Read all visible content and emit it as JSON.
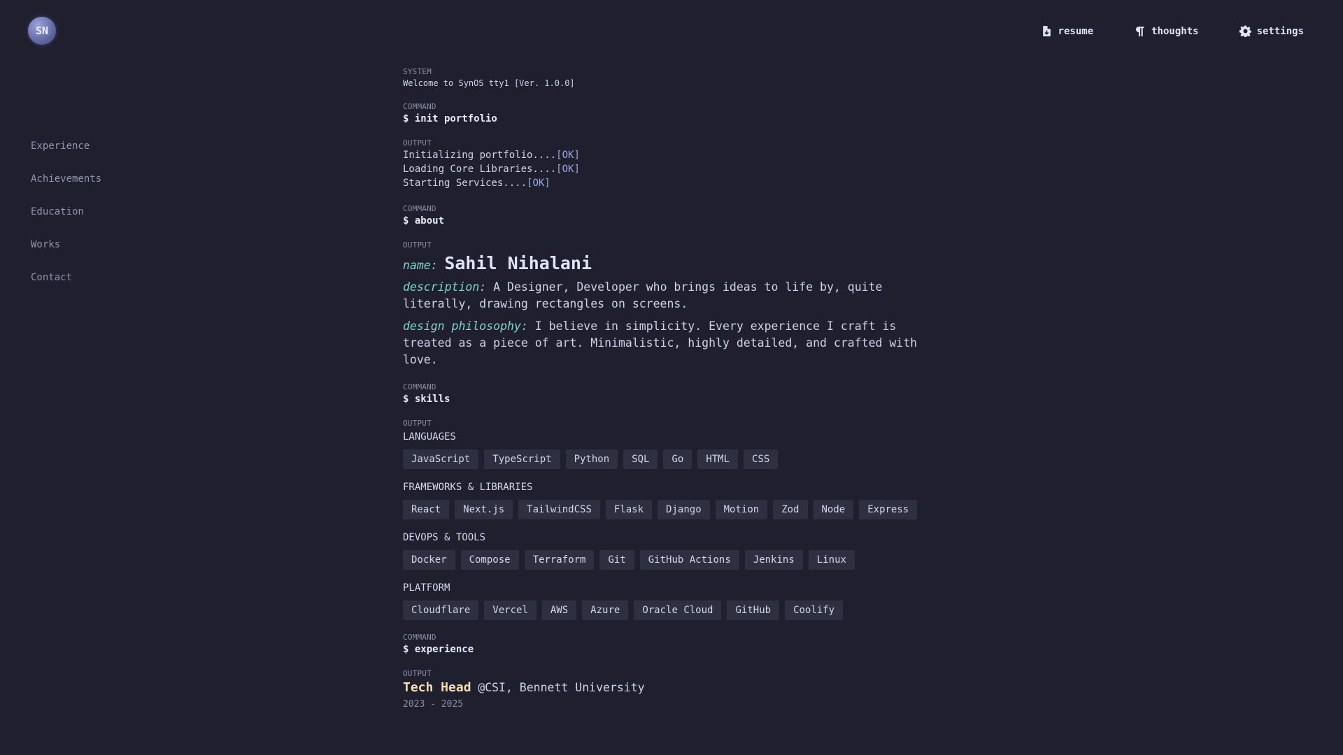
{
  "header": {
    "avatar_initials": "SN",
    "nav": [
      {
        "label": "resume",
        "icon": "document-icon"
      },
      {
        "label": "thoughts",
        "icon": "pilcrow-icon"
      },
      {
        "label": "settings",
        "icon": "gear-icon"
      }
    ]
  },
  "sidebar": {
    "items": [
      "Experience",
      "Achievements",
      "Education",
      "Works",
      "Contact"
    ]
  },
  "terminal": {
    "system": {
      "tag": "SYSTEM",
      "text": "Welcome to SynOS tty1 [Ver. 1.0.0]"
    },
    "cmd_init": {
      "tag": "COMMAND",
      "text": "$ init portfolio"
    },
    "out_init": {
      "tag": "OUTPUT",
      "lines": [
        {
          "text": "Initializing portfolio....",
          "status": "[OK]"
        },
        {
          "text": "Loading Core Libraries....",
          "status": "[OK]"
        },
        {
          "text": "Starting Services....",
          "status": "[OK]"
        }
      ]
    },
    "cmd_about": {
      "tag": "COMMAND",
      "text": "$ about"
    },
    "out_about": {
      "tag": "OUTPUT",
      "name_key": "name:",
      "name": "Sahil Nihalani",
      "desc_key": "description:",
      "desc": "A Designer, Developer who brings ideas to life by, quite literally, drawing rectangles on screens.",
      "philo_key": "design philosophy:",
      "philo": "I believe in simplicity. Every experience I craft is treated as a piece of art. Minimalistic, highly detailed, and crafted with love."
    },
    "cmd_skills": {
      "tag": "COMMAND",
      "text": "$ skills"
    },
    "out_skills": {
      "tag": "OUTPUT",
      "categories": [
        {
          "title": "LANGUAGES",
          "items": [
            "JavaScript",
            "TypeScript",
            "Python",
            "SQL",
            "Go",
            "HTML",
            "CSS"
          ]
        },
        {
          "title": "FRAMEWORKS & LIBRARIES",
          "items": [
            "React",
            "Next.js",
            "TailwindCSS",
            "Flask",
            "Django",
            "Motion",
            "Zod",
            "Node",
            "Express"
          ]
        },
        {
          "title": "DEVOPS & TOOLS",
          "items": [
            "Docker",
            "Compose",
            "Terraform",
            "Git",
            "GitHub Actions",
            "Jenkins",
            "Linux"
          ]
        },
        {
          "title": "PLATFORM",
          "items": [
            "Cloudflare",
            "Vercel",
            "AWS",
            "Azure",
            "Oracle Cloud",
            "GitHub",
            "Coolify"
          ]
        }
      ]
    },
    "cmd_experience": {
      "tag": "COMMAND",
      "text": "$ experience"
    },
    "out_experience": {
      "tag": "OUTPUT",
      "title": "Tech Head",
      "org": "@CSI, Bennett University",
      "dates": "2023 - 2025"
    }
  },
  "colors": {
    "background": "#1f1f2e",
    "accent_key": "#7fd4cf",
    "ok_status": "#9ea7e6",
    "job_title": "#f5ddb0",
    "chip_bg": "#2e2f40"
  }
}
